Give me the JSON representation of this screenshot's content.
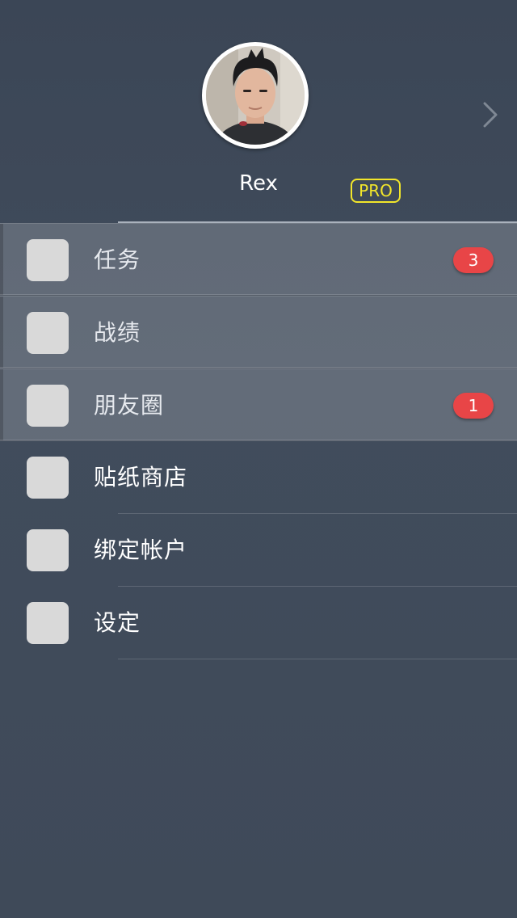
{
  "profile": {
    "name": "Rex",
    "badge": "PRO"
  },
  "colors": {
    "background": "#3f4a5a",
    "pro_badge": "#f2e62a",
    "notification_badge": "#e84547",
    "icon_placeholder": "#d9d9d9"
  },
  "menu": {
    "items": [
      {
        "label": "任务",
        "badge": "3",
        "highlighted": true,
        "icon": "placeholder-icon"
      },
      {
        "label": "战绩",
        "badge": null,
        "highlighted": true,
        "icon": "placeholder-icon"
      },
      {
        "label": "朋友圈",
        "badge": "1",
        "highlighted": true,
        "icon": "placeholder-icon"
      },
      {
        "label": "贴纸商店",
        "badge": null,
        "highlighted": false,
        "icon": "placeholder-icon"
      },
      {
        "label": "绑定帐户",
        "badge": null,
        "highlighted": false,
        "icon": "placeholder-icon"
      },
      {
        "label": "设定",
        "badge": null,
        "highlighted": false,
        "icon": "placeholder-icon"
      }
    ]
  }
}
